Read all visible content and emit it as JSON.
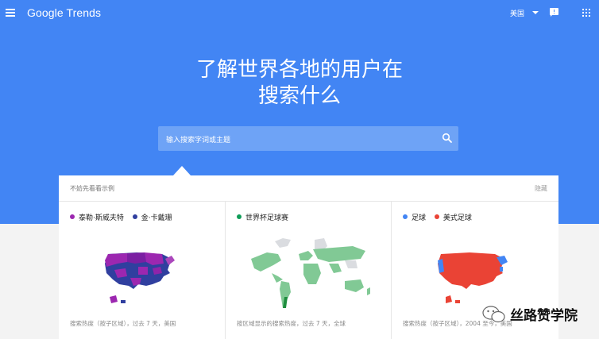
{
  "header": {
    "logo": "Google Trends",
    "region": "美国"
  },
  "hero": {
    "title_line1": "了解世界各地的用户在",
    "title_line2": "搜索什么"
  },
  "search": {
    "placeholder": "输入搜索字词或主题"
  },
  "examples": {
    "title": "不妨先看看示例",
    "hide_label": "隐藏",
    "cards": [
      {
        "legend": [
          {
            "label": "泰勒·斯威夫特",
            "color": "#9c27b0"
          },
          {
            "label": "金·卡戴珊",
            "color": "#303f9f"
          }
        ],
        "caption": "搜索热度（按子区域），过去 7 天，美国"
      },
      {
        "legend": [
          {
            "label": "世界杯足球赛",
            "color": "#0f9d58"
          }
        ],
        "caption": "按区域显示的搜索热度，过去 7 天，全球"
      },
      {
        "legend": [
          {
            "label": "足球",
            "color": "#4285f4"
          },
          {
            "label": "美式足球",
            "color": "#ea4335"
          }
        ],
        "caption": "搜索热度（按子区域），2004 至今，美国"
      }
    ]
  },
  "watermark": {
    "text": "丝路赞学院"
  }
}
